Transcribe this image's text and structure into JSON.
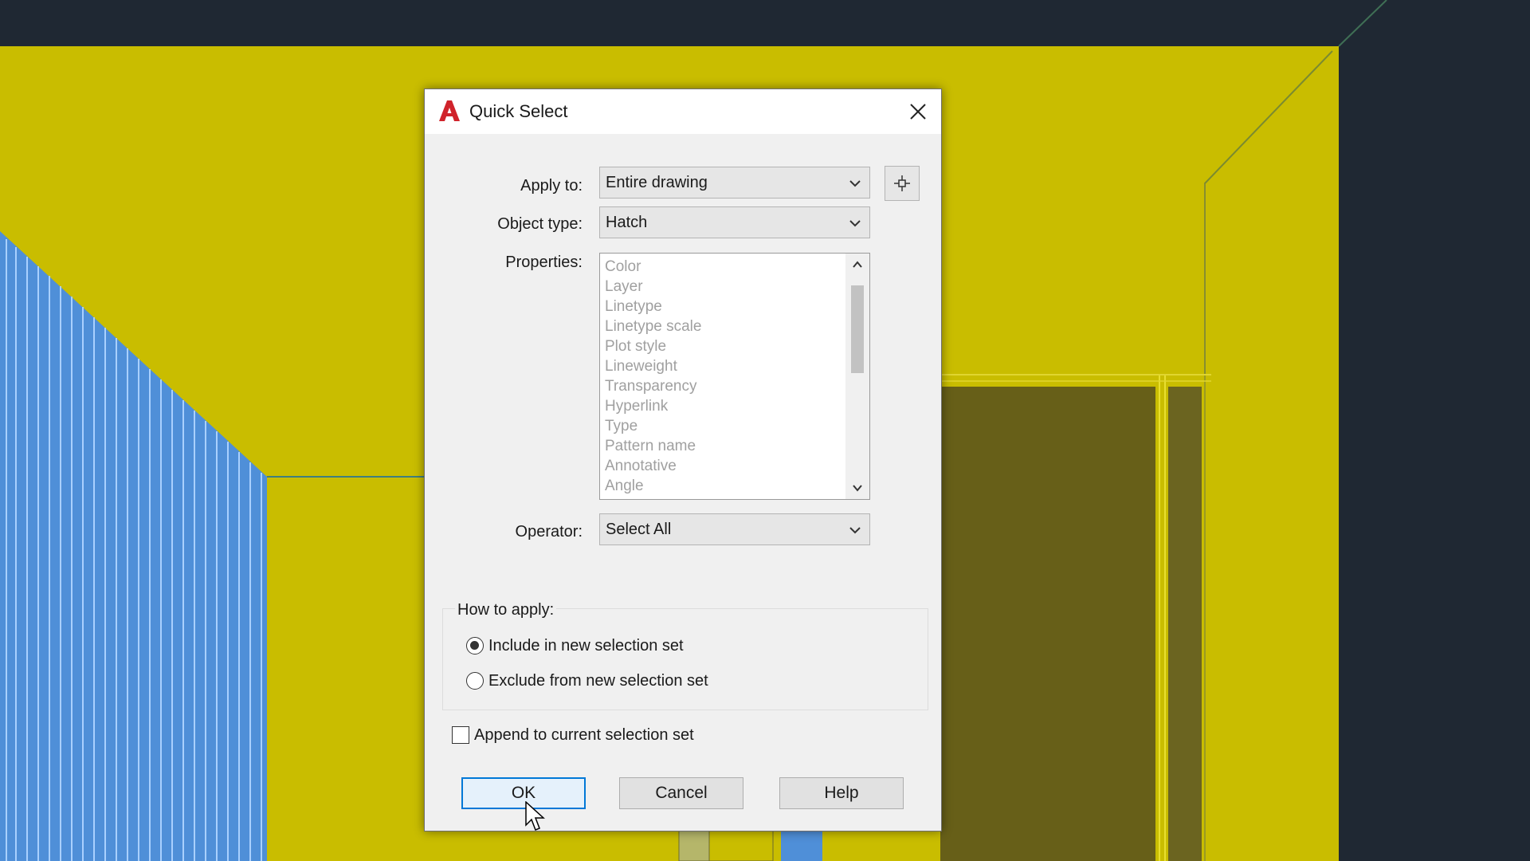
{
  "dialog": {
    "title": "Quick Select",
    "app_icon": "autocad-logo-icon",
    "close_icon": "close-icon"
  },
  "fields": {
    "apply_to_label": "Apply to:",
    "apply_to_value": "Entire drawing",
    "select_objects_icon": "select-objects-crosshair-icon",
    "object_type_label": "Object type:",
    "object_type_value": "Hatch",
    "properties_label": "Properties:",
    "properties": [
      "Color",
      "Layer",
      "Linetype",
      "Linetype scale",
      "Plot style",
      "Lineweight",
      "Transparency",
      "Hyperlink",
      "Type",
      "Pattern name",
      "Annotative",
      "Angle"
    ],
    "operator_label": "Operator:",
    "operator_value": "Select All"
  },
  "how_to_apply": {
    "title": "How to apply:",
    "include_label": "Include in new selection set",
    "exclude_label": "Exclude from new selection set",
    "selected": "include"
  },
  "append_label": "Append to current selection set",
  "append_checked": false,
  "buttons": {
    "ok": "OK",
    "cancel": "Cancel",
    "help": "Help"
  },
  "colors": {
    "drawing_background": "#1f2833",
    "hatch_yellow": "#c9bd00",
    "hatch_dark": "#675f18",
    "accent_blue": "#0078d7"
  }
}
